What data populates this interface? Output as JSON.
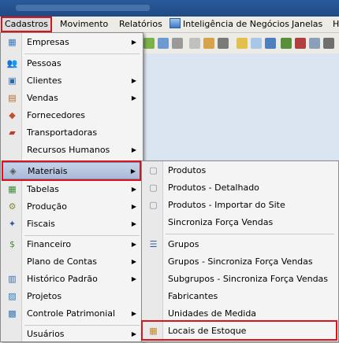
{
  "menubar": [
    {
      "label": "Cadastros",
      "active": true
    },
    {
      "label": "Movimento"
    },
    {
      "label": "Relatórios"
    },
    {
      "label": "Inteligência de Negócios",
      "icon": "bi-app-icon"
    },
    {
      "label": "Janelas"
    },
    {
      "label": "H"
    }
  ],
  "cadastros_menu": [
    {
      "label": "Empresas",
      "icon": "buildings-icon",
      "submenu": true
    },
    {
      "label": "Pessoas",
      "icon": "people-icon"
    },
    {
      "label": "Clientes",
      "icon": "client-card-icon",
      "submenu": true
    },
    {
      "label": "Vendas",
      "icon": "briefcase-icon",
      "submenu": true
    },
    {
      "label": "Fornecedores",
      "icon": "supplier-icon"
    },
    {
      "label": "Transportadoras",
      "icon": "truck-icon"
    },
    {
      "label": "Recursos Humanos",
      "icon": "blank-icon",
      "submenu": true
    },
    {
      "label": "Materiais",
      "icon": "materials-box-icon",
      "submenu": true,
      "highlighted": true
    },
    {
      "label": "Tabelas",
      "icon": "table-icon",
      "submenu": true
    },
    {
      "label": "Produção",
      "icon": "gears-icon",
      "submenu": true
    },
    {
      "label": "Fiscais",
      "icon": "fiscal-icon",
      "submenu": true
    },
    {
      "label": "Financeiro",
      "icon": "money-icon",
      "submenu": true
    },
    {
      "label": "Plano de Contas",
      "icon": "blank-icon",
      "submenu": true
    },
    {
      "label": "Histórico Padrão",
      "icon": "history-icon",
      "submenu": true
    },
    {
      "label": "Projetos",
      "icon": "projects-icon"
    },
    {
      "label": "Controle Patrimonial",
      "icon": "asset-icon",
      "submenu": true
    },
    {
      "label": "Usuários",
      "icon": "blank-icon",
      "submenu": true
    }
  ],
  "materiais_menu": [
    {
      "label": "Produtos",
      "icon": "box-icon"
    },
    {
      "label": "Produtos - Detalhado",
      "icon": "box-icon"
    },
    {
      "label": "Produtos - Importar do Site",
      "icon": "box-icon"
    },
    {
      "label": "Sincroniza Força Vendas",
      "icon": "blank-icon"
    },
    {
      "label": "Grupos",
      "icon": "list-icon"
    },
    {
      "label": "Grupos - Sincroniza Força Vendas",
      "icon": "blank-icon"
    },
    {
      "label": "Subgrupos - Sincroniza Força Vendas",
      "icon": "blank-icon"
    },
    {
      "label": "Fabricantes",
      "icon": "blank-icon"
    },
    {
      "label": "Unidades de Medida",
      "icon": "blank-icon"
    },
    {
      "label": "Locais de Estoque",
      "icon": "warehouse-icon",
      "highlighted_box": true
    }
  ],
  "colors": {
    "accent_red": "#d9141b",
    "highlight": "#b4c3de"
  }
}
